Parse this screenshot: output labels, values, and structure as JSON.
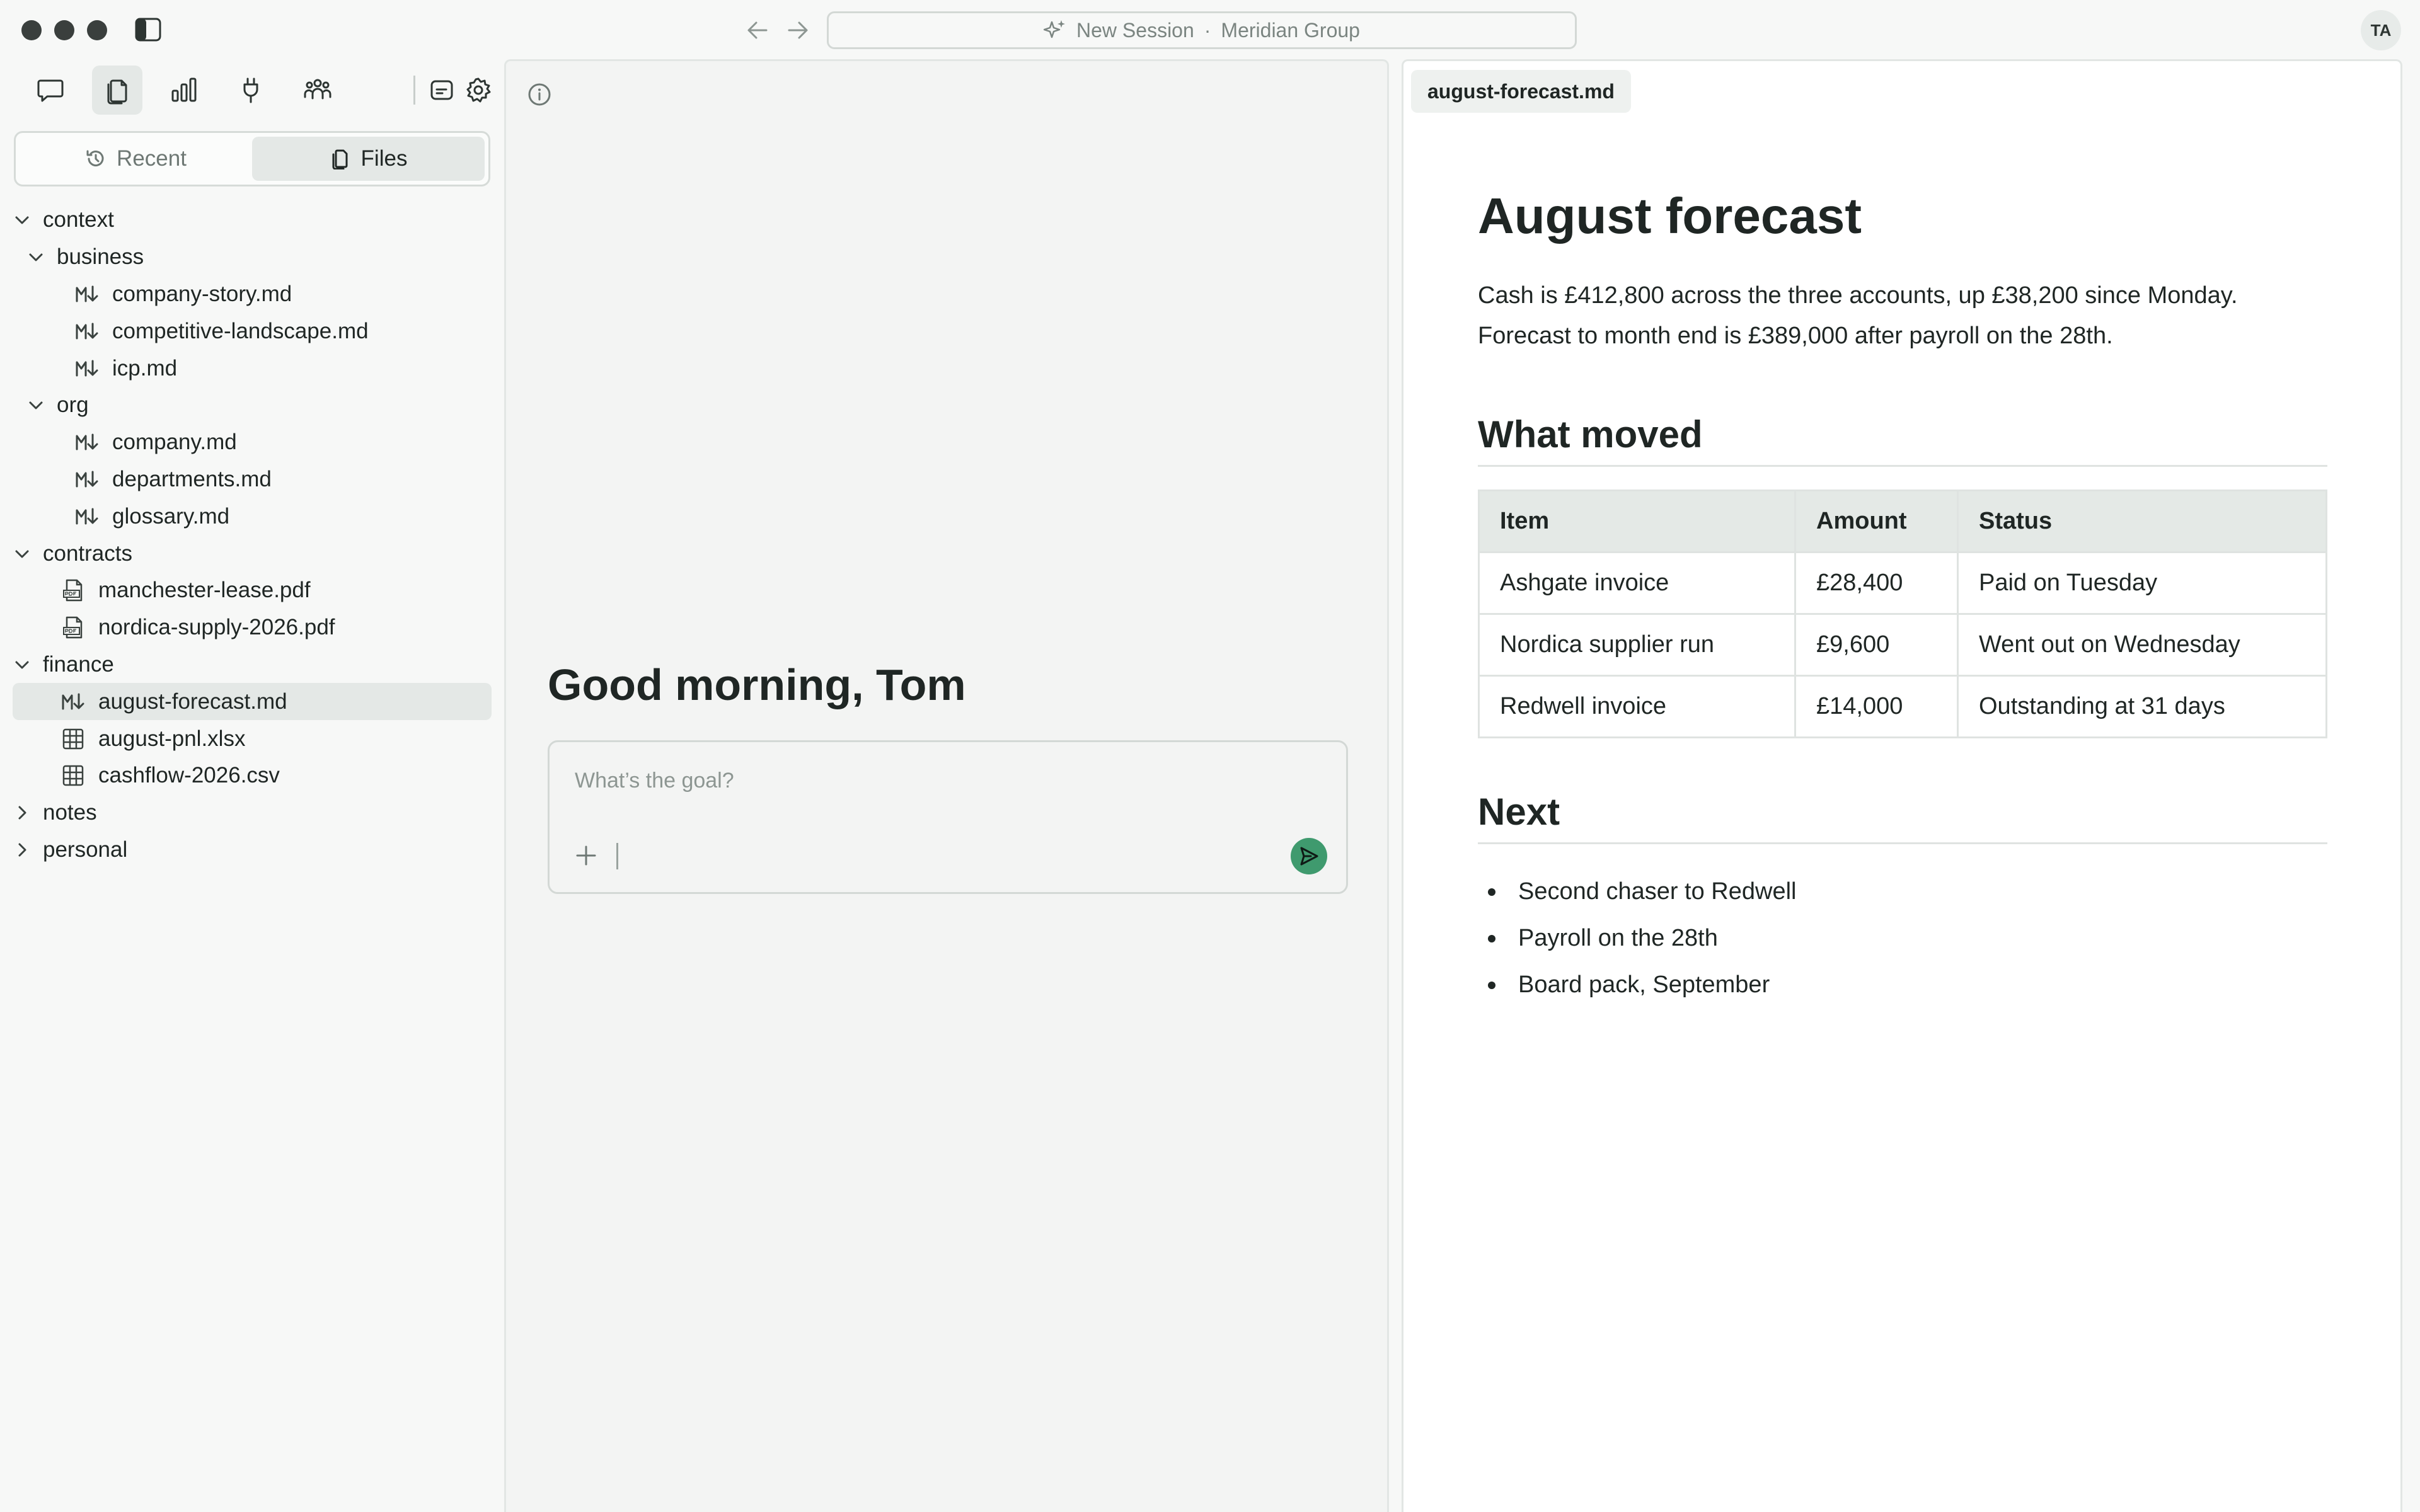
{
  "window": {
    "session_label": "New Session",
    "separator": "·",
    "workspace": "Meridian Group",
    "user_initials": "TA"
  },
  "sidebar": {
    "tabs": {
      "recent": "Recent",
      "files": "Files",
      "active": "files"
    },
    "tree": [
      {
        "label": "context",
        "type": "folder",
        "depth": 0,
        "expanded": true
      },
      {
        "label": "business",
        "type": "folder",
        "depth": 1,
        "expanded": true
      },
      {
        "label": "company-story.md",
        "type": "md",
        "depth": 2
      },
      {
        "label": "competitive-landscape.md",
        "type": "md",
        "depth": 2
      },
      {
        "label": "icp.md",
        "type": "md",
        "depth": 2
      },
      {
        "label": "org",
        "type": "folder",
        "depth": 1,
        "expanded": true
      },
      {
        "label": "company.md",
        "type": "md",
        "depth": 2
      },
      {
        "label": "departments.md",
        "type": "md",
        "depth": 2
      },
      {
        "label": "glossary.md",
        "type": "md",
        "depth": 2
      },
      {
        "label": "contracts",
        "type": "folder",
        "depth": 0,
        "expanded": true
      },
      {
        "label": "manchester-lease.pdf",
        "type": "pdf",
        "depth": 1
      },
      {
        "label": "nordica-supply-2026.pdf",
        "type": "pdf",
        "depth": 1
      },
      {
        "label": "finance",
        "type": "folder",
        "depth": 0,
        "expanded": true
      },
      {
        "label": "august-forecast.md",
        "type": "md",
        "depth": 1,
        "selected": true
      },
      {
        "label": "august-pnl.xlsx",
        "type": "sheet",
        "depth": 1
      },
      {
        "label": "cashflow-2026.csv",
        "type": "sheet",
        "depth": 1
      },
      {
        "label": "notes",
        "type": "folder",
        "depth": 0,
        "expanded": false
      },
      {
        "label": "personal",
        "type": "folder",
        "depth": 0,
        "expanded": false
      }
    ]
  },
  "chat": {
    "greeting": "Good morning, Tom",
    "input_placeholder": "What’s the goal?",
    "input_value": ""
  },
  "document": {
    "tab_label": "august-forecast.md",
    "title": "August forecast",
    "intro": "Cash is £412,800 across the three accounts, up £38,200 since Monday. Forecast to month end is £389,000 after payroll on the 28th.",
    "section1": "What moved",
    "table": {
      "headers": [
        "Item",
        "Amount",
        "Status"
      ],
      "rows": [
        [
          "Ashgate invoice",
          "£28,400",
          "Paid on Tuesday"
        ],
        [
          "Nordica supplier run",
          "£9,600",
          "Went out on Wednesday"
        ],
        [
          "Redwell invoice",
          "£14,000",
          "Outstanding at 31 days"
        ]
      ]
    },
    "section2": "Next",
    "bullets": [
      "Second chaser to Redwell",
      "Payroll on the 28th",
      "Board pack, September"
    ]
  },
  "colors": {
    "accent": "#3f9a6e",
    "selected_bg": "#e4e8e6",
    "table_header_bg": "#e4e9e6"
  }
}
